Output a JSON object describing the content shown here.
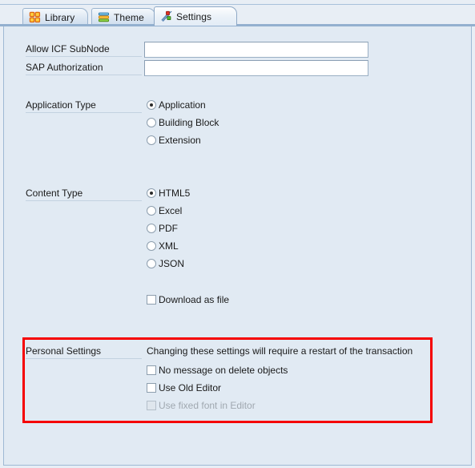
{
  "window": {
    "background_color": "#e1eaf3",
    "accent_color": "#93b0cf"
  },
  "tabs": [
    {
      "id": "library",
      "label": "Library",
      "icon": "library-grid-icon",
      "active": false
    },
    {
      "id": "theme",
      "label": "Theme",
      "icon": "theme-stack-icon",
      "active": false
    },
    {
      "id": "settings",
      "label": "Settings",
      "icon": "settings-tools-icon",
      "active": true
    }
  ],
  "form": {
    "allow_icf_subnode": {
      "label": "Allow ICF SubNode",
      "value": "",
      "placeholder": ""
    },
    "sap_authorization": {
      "label": "SAP Authorization",
      "value": "",
      "placeholder": ""
    },
    "application_type": {
      "label": "Application Type",
      "selected": "Application",
      "options": [
        {
          "label": "Application",
          "checked": true
        },
        {
          "label": "Building Block",
          "checked": false
        },
        {
          "label": "Extension",
          "checked": false
        }
      ]
    },
    "content_type": {
      "label": "Content Type",
      "selected": "HTML5",
      "options": [
        {
          "label": "HTML5",
          "checked": true
        },
        {
          "label": "Excel",
          "checked": false
        },
        {
          "label": "PDF",
          "checked": false
        },
        {
          "label": "XML",
          "checked": false
        },
        {
          "label": "JSON",
          "checked": false
        }
      ]
    },
    "download_as_file": {
      "label": "Download as file",
      "checked": false
    },
    "personal_settings": {
      "label": "Personal Settings",
      "note": "Changing these settings will require a restart of the transaction",
      "highlight_color": "#f50000",
      "options": [
        {
          "label": "No message on delete objects",
          "checked": false,
          "disabled": false
        },
        {
          "label": "Use Old Editor",
          "checked": false,
          "disabled": false
        },
        {
          "label": "Use fixed font in Editor",
          "checked": false,
          "disabled": true
        }
      ]
    }
  }
}
